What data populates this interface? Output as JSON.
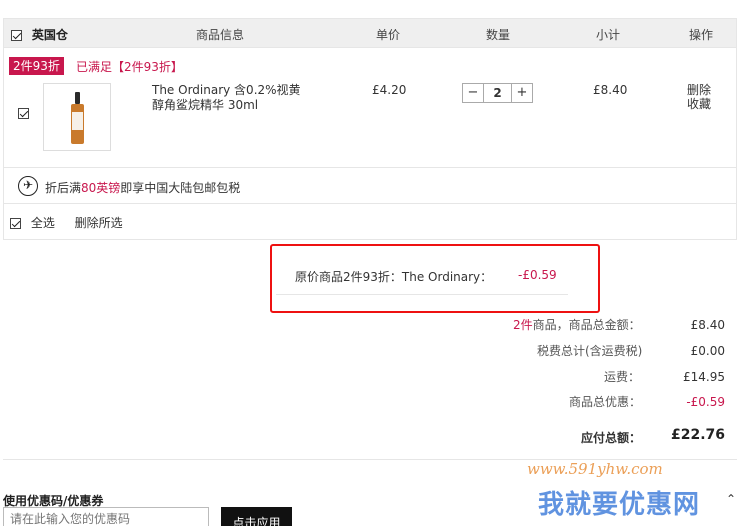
{
  "header": {
    "warehouse": "英国仓",
    "col_info": "商品信息",
    "col_price": "单价",
    "col_qty": "数量",
    "col_subtotal": "小计",
    "col_ops": "操作"
  },
  "promo": {
    "tag": "2件93折",
    "status": "已满足【2件93折】"
  },
  "product": {
    "name": "The Ordinary 含0.2%视黄醇角鲨烷精华 30ml",
    "price": "£4.20",
    "qty_minus": "−",
    "qty": "2",
    "qty_plus": "+",
    "subtotal": "£8.40",
    "op_delete": "删除",
    "op_fav": "收藏"
  },
  "shipping": {
    "icon": "plane-icon",
    "pre": "折后满",
    "amount": "80英镑",
    "post": "即享中国大陆包邮包税"
  },
  "footer_actions": {
    "select_all": "全选",
    "delete_selected": "删除所选"
  },
  "discount_box": {
    "label": "原价商品2件93折：The Ordinary：",
    "value": "-£0.59"
  },
  "summary": {
    "count_pre": "2件",
    "count_label": "商品，商品总金额：",
    "goods_total": "£8.40",
    "tax_label": "税费总计(含运费税)",
    "tax_value": "£0.00",
    "ship_label": "运费：",
    "ship_value": "£14.95",
    "disc_label": "商品总优惠：",
    "disc_value": "-£0.59",
    "pay_label": "应付总额：",
    "pay_value": "£22.76"
  },
  "coupon": {
    "title": "使用优惠码/优惠券",
    "placeholder": "请在此输入您的优惠码",
    "apply": "点击应用"
  },
  "watermark": {
    "url": "www.591yhw.com",
    "text": "我就要优惠网"
  },
  "colors": {
    "accent_red": "#c8174d",
    "highlight_box": "#e11111"
  }
}
